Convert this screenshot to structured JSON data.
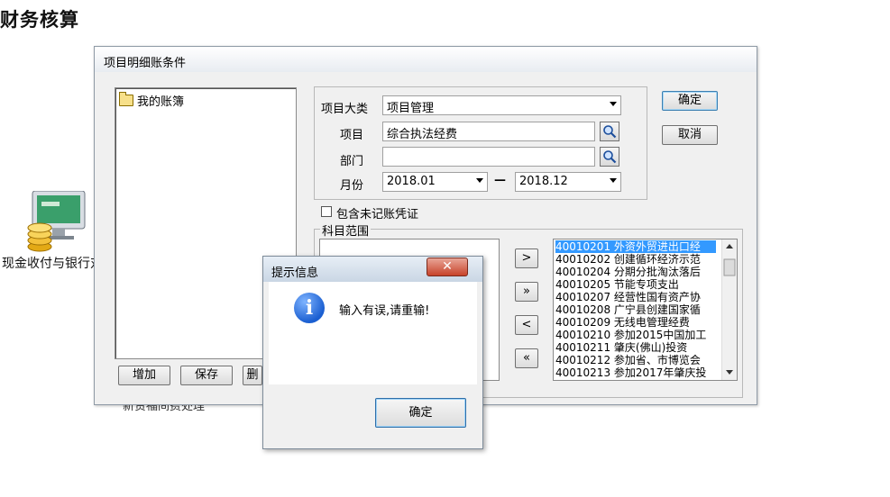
{
  "page": {
    "title": "财务核算",
    "desktop_icon_label": "现金收付与银行对账",
    "background_text": "新赁福间费处理"
  },
  "dialog": {
    "title": "项目明细账条件",
    "tree": {
      "root_label": "我的账簿"
    },
    "buttons": {
      "add": "增加",
      "save": "保存",
      "delete": "删",
      "ok": "确定",
      "cancel": "取消"
    },
    "fields": {
      "category_label": "项目大类",
      "category_value": "项目管理",
      "item_label": "项目",
      "item_value": "综合执法经费",
      "dept_label": "部门",
      "dept_value": "",
      "month_label": "月份",
      "month_from": "2018.01",
      "month_to": "2018.12",
      "dash": "—"
    },
    "checkbox_label": "包含未记账凭证",
    "subject_range": {
      "legend": "科目范围",
      "move_buttons": [
        ">",
        "»",
        "<",
        "«"
      ],
      "available": [
        "40010201 外资外贸进出口经",
        "40010202 创建循环经济示范",
        "40010204 分期分批淘汰落后",
        "40010205 节能专项支出",
        "40010207 经营性国有资产协",
        "40010208 广宁县创建国家循",
        "40010209 无线电管理经费",
        "40010210 参加2015中国加工",
        "40010211 肇庆(佛山)投资",
        "40010212 参加省、市博览会",
        "40010213 参加2017年肇庆投"
      ]
    }
  },
  "message_box": {
    "title": "提示信息",
    "close_glyph": "✕",
    "icon_glyph": "i",
    "text": "输入有误,请重输!",
    "ok_label": "确定"
  }
}
